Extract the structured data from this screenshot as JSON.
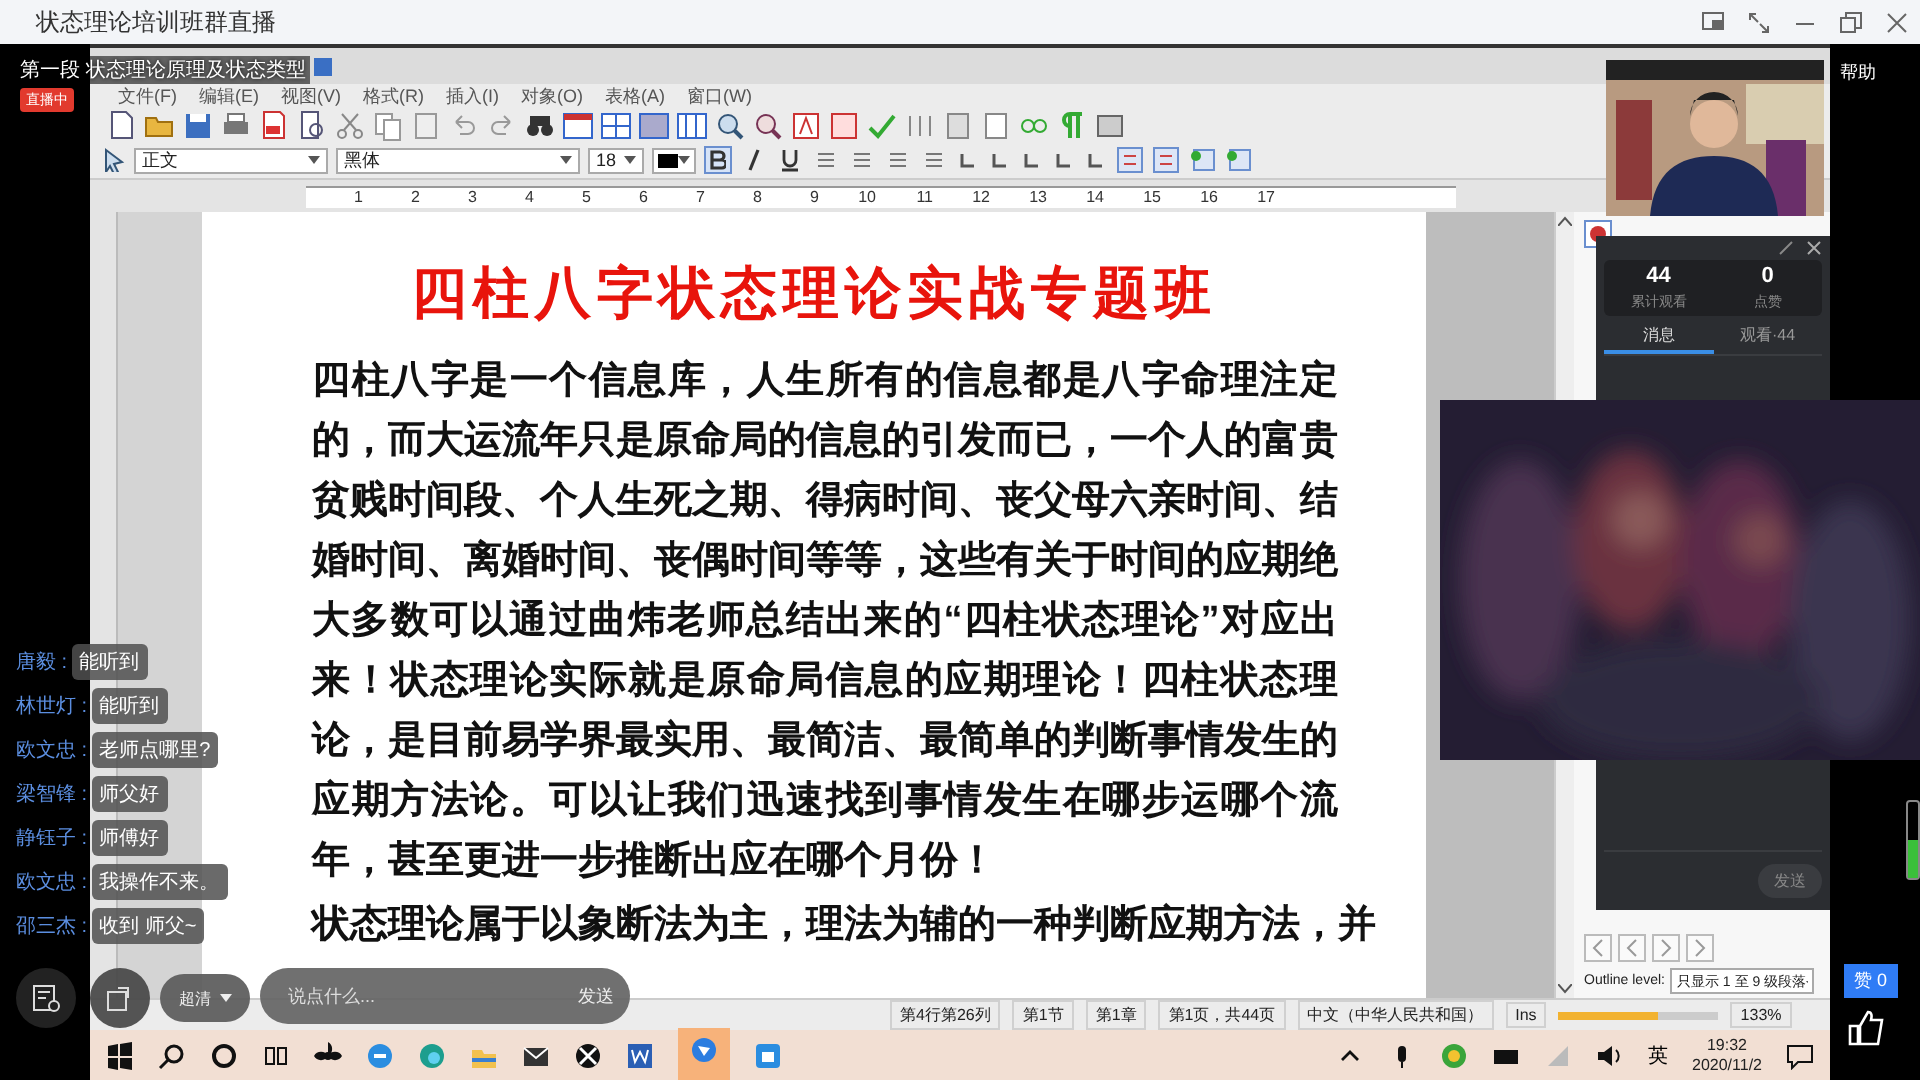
{
  "app": {
    "title": "状态理论培训班群直播",
    "help": "帮助"
  },
  "stream": {
    "segment": "第一段 状态理论原理及状态类型",
    "live_badge": "直播中",
    "likes": "赞 0"
  },
  "mic_meter": {
    "level": 0.5
  },
  "word": {
    "menu": [
      "文件(F)",
      "编辑(E)",
      "视图(V)",
      "格式(R)",
      "插入(I)",
      "对象(O)",
      "表格(A)",
      "窗口(W)"
    ],
    "style": "正文",
    "font": "黑体",
    "size": "18",
    "bold": true,
    "ruler": [
      "1",
      "2",
      "3",
      "4",
      "5",
      "6",
      "7",
      "8",
      "9",
      "10",
      "11",
      "12",
      "13",
      "14",
      "15",
      "16",
      "17"
    ],
    "title": "四柱八字状态理论实战专题班",
    "paragraph": "四柱八字是一个信息库，人生所有的信息都是八字命理注定的，而大运流年只是原命局的信息的引发而已，一个人的富贵贫贱时间段、个人生死之期、得病时间、丧父母六亲时间、结婚时间、离婚时间、丧偶时间等等，这些有关于时间的应期绝大多数可以通过曲炜老师总结出来的“四柱状态理论”对应出来！状态理论实际就是原命局信息的应期理论！四柱状态理论，是目前易学界最实用、最简洁、最简单的判断事情发生的应期方法论。可以让我们迅速找到事情发生在哪步运哪个流年，甚至更进一步推断出应在哪个月份！",
    "next_line": "状态理论属于以象断法为主，理法为辅的一种判断应期方法，并",
    "outline_label": "Outline level:",
    "outline_value": "只显示 1 至 9 级段落",
    "zoom_slider": {
      "level": 0.62
    },
    "status": [
      "第4行第26列",
      "第1节",
      "第1章",
      "第1页，共44页",
      "中文（中华人民共和国）",
      "Ins",
      "133%"
    ]
  },
  "chat": [
    {
      "name": "唐毅 :",
      "text": "能听到"
    },
    {
      "name": "林世灯 :",
      "text": "能听到"
    },
    {
      "name": "欧文忠 :",
      "text": "老师点哪里?"
    },
    {
      "name": "梁智锋 :",
      "text": "师父好"
    },
    {
      "name": "静钰子 :",
      "text": "师傅好"
    },
    {
      "name": "欧文忠 :",
      "text": "我操作不来。"
    },
    {
      "name": "邵三杰 :",
      "text": "收到 师父~"
    }
  ],
  "controls": {
    "quality": "超清",
    "placeholder": "说点什么...",
    "send": "发送"
  },
  "panel": {
    "viewers": "44",
    "viewers_label": "累计观看",
    "likes": "0",
    "likes_label": "点赞",
    "tabs": [
      {
        "label": "消息",
        "selected": true
      },
      {
        "label": "观看·44",
        "selected": false
      }
    ],
    "send": "发送"
  },
  "taskbar": {
    "ime": "英",
    "time": "19:32",
    "date": "2020/11/2"
  }
}
